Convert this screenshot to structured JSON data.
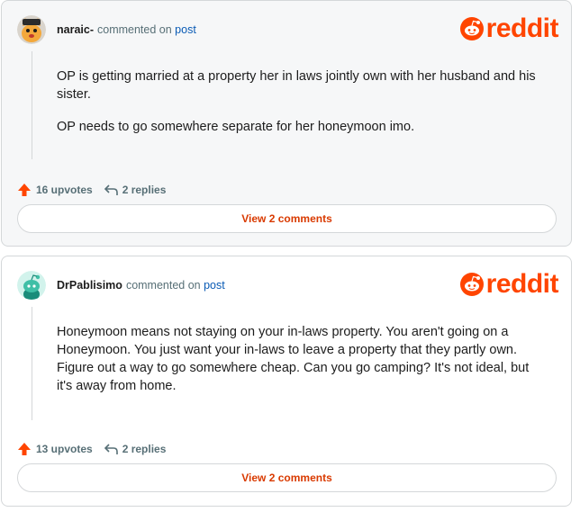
{
  "comments": [
    {
      "author": "naraic-",
      "meta_text": "commented on",
      "post_link": "post",
      "brand": "reddit",
      "body": [
        "OP is getting married at a property her in laws jointly own with her husband and his sister.",
        "OP needs to go somewhere separate for her honeymoon imo."
      ],
      "upvotes": "16 upvotes",
      "replies": "2 replies",
      "view_button": "View 2 comments",
      "avatar_icon": "cat-avatar-icon"
    },
    {
      "author": "DrPablisimo",
      "meta_text": "commented on",
      "post_link": "post",
      "brand": "reddit",
      "body": [
        "Honeymoon means not staying on your in-laws property. You aren't going on a Honeymoon. You just want your in-laws to leave a property that they partly own. Figure out a way to go somewhere cheap. Can you go camping? It's not ideal, but it's away from home."
      ],
      "upvotes": "13 upvotes",
      "replies": "2 replies",
      "view_button": "View 2 comments",
      "avatar_icon": "snoo-avatar-icon"
    }
  ],
  "colors": {
    "brand": "#ff4500",
    "link": "#0a5bb5",
    "button_text": "#d93a00",
    "meta": "#576f76"
  }
}
